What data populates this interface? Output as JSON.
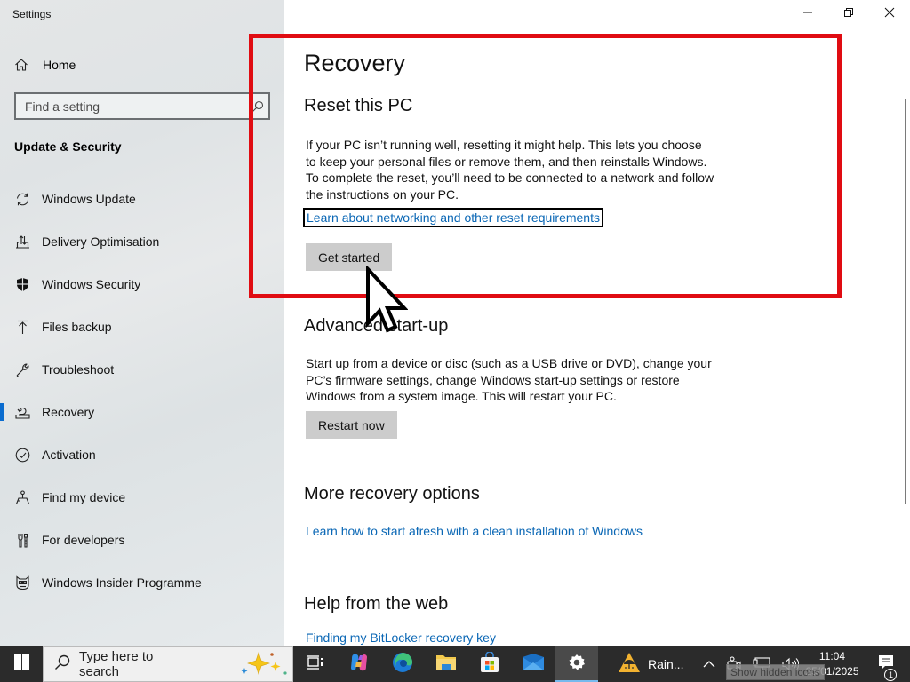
{
  "window": {
    "title": "Settings",
    "controls": {
      "minimize": "minimize",
      "restore": "restore",
      "close": "close"
    }
  },
  "sidebar": {
    "home_label": "Home",
    "search_placeholder": "Find a setting",
    "search_value": "",
    "section_title": "Update & Security",
    "items": [
      {
        "label": "Windows Update",
        "icon": "sync-icon",
        "active": false
      },
      {
        "label": "Delivery Optimisation",
        "icon": "delivery-optimisation-icon",
        "active": false
      },
      {
        "label": "Windows Security",
        "icon": "shield-icon",
        "active": false
      },
      {
        "label": "Files backup",
        "icon": "upload-arrow-icon",
        "active": false
      },
      {
        "label": "Troubleshoot",
        "icon": "wrench-icon",
        "active": false
      },
      {
        "label": "Recovery",
        "icon": "recovery-icon",
        "active": true
      },
      {
        "label": "Activation",
        "icon": "check-circle-icon",
        "active": false
      },
      {
        "label": "Find my device",
        "icon": "find-device-icon",
        "active": false
      },
      {
        "label": "For developers",
        "icon": "developer-tools-icon",
        "active": false
      },
      {
        "label": "Windows Insider Programme",
        "icon": "insider-cat-icon",
        "active": false
      }
    ],
    "accent_color": "#0a6ccf"
  },
  "main": {
    "page_title": "Recovery",
    "reset": {
      "heading": "Reset this PC",
      "description": "If your PC isn’t running well, resetting it might help. This lets you choose to keep your personal files or remove them, and then reinstalls Windows. To complete the reset, you’ll need to be connected to a network and follow the instructions on your PC.",
      "link": "Learn about networking and other reset requirements",
      "button": "Get started"
    },
    "advanced": {
      "heading": "Advanced start-up",
      "description": "Start up from a device or disc (such as a USB drive or DVD), change your PC’s firmware settings, change Windows start-up settings or restore Windows from a system image. This will restart your PC.",
      "button": "Restart now"
    },
    "more": {
      "heading": "More recovery options",
      "link": "Learn how to start afresh with a clean installation of Windows"
    },
    "help": {
      "heading": "Help from the web",
      "link": "Finding my BitLocker recovery key"
    },
    "link_color": "#0a67b5"
  },
  "annotation": {
    "highlight_color": "#e00c12"
  },
  "taskbar": {
    "search_placeholder": "Type here to search",
    "pinned": [
      {
        "name": "task-view",
        "active": false
      },
      {
        "name": "copilot",
        "active": false
      },
      {
        "name": "edge",
        "active": false
      },
      {
        "name": "file-explorer",
        "active": false
      },
      {
        "name": "microsoft-store",
        "active": false
      },
      {
        "name": "mail",
        "active": false
      },
      {
        "name": "settings",
        "active": true
      }
    ],
    "weather": "Rain...",
    "tooltip": "Show hidden icons",
    "time": "11:04",
    "date": "25/01/2025",
    "notification_count": "1"
  }
}
